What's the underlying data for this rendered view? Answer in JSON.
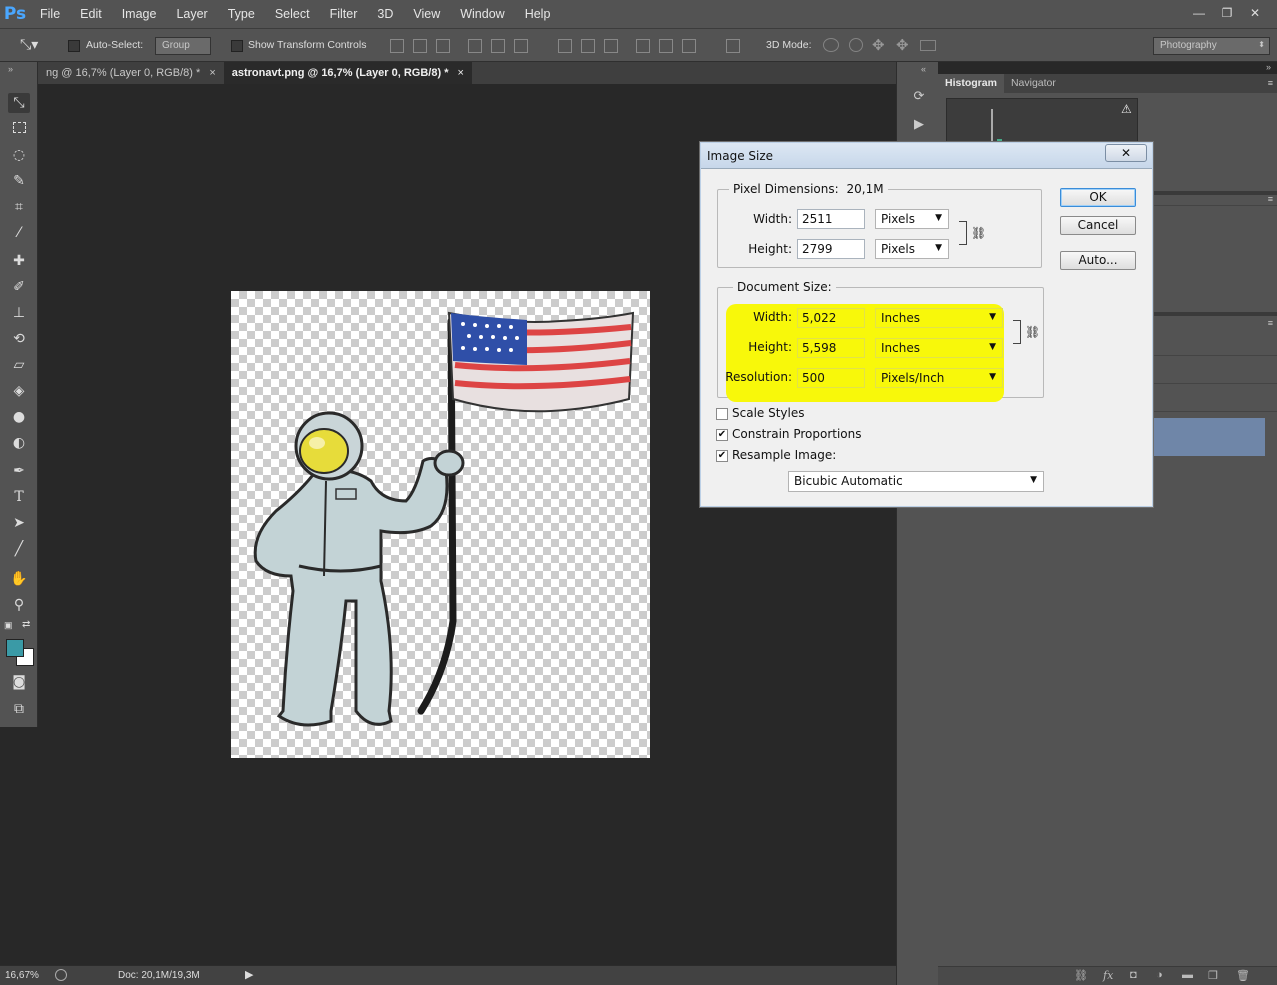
{
  "app": {
    "logo": "Ps"
  },
  "menu": [
    "File",
    "Edit",
    "Image",
    "Layer",
    "Type",
    "Select",
    "Filter",
    "3D",
    "View",
    "Window",
    "Help"
  ],
  "window_controls": {
    "minimize": "—",
    "restore": "❐",
    "close": "✕"
  },
  "options_bar": {
    "auto_select_label": "Auto-Select:",
    "auto_select_value": "Group",
    "show_transform_label": "Show Transform Controls",
    "mode_3d_label": "3D Mode:",
    "workspace": "Photography"
  },
  "tabs": [
    {
      "label": "ng @ 16,7% (Layer 0, RGB/8) *",
      "close": "×"
    },
    {
      "label": "astronavt.png @ 16,7% (Layer 0, RGB/8) *",
      "close": "×"
    }
  ],
  "status": {
    "zoom": "16,67%",
    "doc": "Doc: 20,1M/19,3M"
  },
  "panels": {
    "histogram_tab": "Histogram",
    "navigator_tab": "Navigator",
    "warning": "⚠"
  },
  "colors": {
    "foreground": "#3a9aa6",
    "background": "#ffffff",
    "highlight": "#f8f80a"
  },
  "dialog": {
    "title": "Image Size",
    "close": "✕",
    "pixel_dimensions_label": "Pixel Dimensions:",
    "pixel_dimensions_value": "20,1M",
    "px_width_label": "Width:",
    "px_width_value": "2511",
    "px_width_unit": "Pixels",
    "px_height_label": "Height:",
    "px_height_value": "2799",
    "px_height_unit": "Pixels",
    "document_size_label": "Document Size:",
    "doc_width_label": "Width:",
    "doc_width_value": "5,022",
    "doc_width_unit": "Inches",
    "doc_height_label": "Height:",
    "doc_height_value": "5,598",
    "doc_height_unit": "Inches",
    "resolution_label": "Resolution:",
    "resolution_value": "500",
    "resolution_unit": "Pixels/Inch",
    "scale_styles_label": "Scale Styles",
    "scale_styles_checked": false,
    "constrain_label": "Constrain Proportions",
    "constrain_checked": true,
    "resample_label": "Resample Image:",
    "resample_checked": true,
    "resample_method": "Bicubic Automatic",
    "ok": "OK",
    "cancel": "Cancel",
    "auto": "Auto..."
  }
}
